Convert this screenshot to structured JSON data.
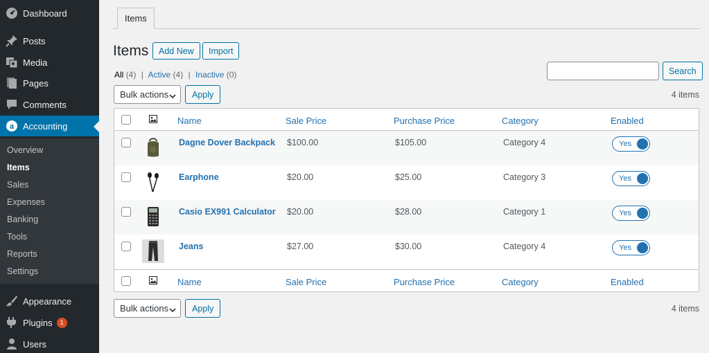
{
  "sidebar": {
    "items_top": [
      {
        "label": "Dashboard",
        "icon": "dashboard-icon"
      },
      {
        "label": "Posts",
        "icon": "pin-icon"
      },
      {
        "label": "Media",
        "icon": "media-icon"
      },
      {
        "label": "Pages",
        "icon": "pages-icon"
      },
      {
        "label": "Comments",
        "icon": "comment-icon"
      },
      {
        "label": "Accounting",
        "icon": "accounting-icon"
      }
    ],
    "submenu": [
      "Overview",
      "Items",
      "Sales",
      "Expenses",
      "Banking",
      "Tools",
      "Reports",
      "Settings"
    ],
    "items_bottom": [
      {
        "label": "Appearance",
        "icon": "brush-icon"
      },
      {
        "label": "Plugins",
        "icon": "plugin-icon",
        "badge": "1"
      },
      {
        "label": "Users",
        "icon": "user-icon"
      }
    ]
  },
  "tabs": [
    "Items"
  ],
  "header": {
    "title": "Items",
    "add_new": "Add New",
    "import": "Import"
  },
  "filters": {
    "all": "All",
    "all_count": "(4)",
    "active": "Active",
    "active_count": "(4)",
    "inactive": "Inactive",
    "inactive_count": "(0)",
    "sep": "|"
  },
  "search": {
    "button": "Search",
    "value": ""
  },
  "bulk": {
    "label": "Bulk actions",
    "apply": "Apply",
    "count": "4 items"
  },
  "table": {
    "columns": [
      "Name",
      "Sale Price",
      "Purchase Price",
      "Category",
      "Enabled"
    ],
    "rows": [
      {
        "name": "Dagne Dover Backpack",
        "sale": "$100.00",
        "purchase": "$105.00",
        "category": "Category 4",
        "enabled": "Yes",
        "thumb": "backpack"
      },
      {
        "name": "Earphone",
        "sale": "$20.00",
        "purchase": "$25.00",
        "category": "Category 3",
        "enabled": "Yes",
        "thumb": "earphone"
      },
      {
        "name": "Casio EX991 Calculator",
        "sale": "$20.00",
        "purchase": "$28.00",
        "category": "Category 1",
        "enabled": "Yes",
        "thumb": "calculator"
      },
      {
        "name": "Jeans",
        "sale": "$27.00",
        "purchase": "$30.00",
        "category": "Category 4",
        "enabled": "Yes",
        "thumb": "jeans"
      }
    ]
  },
  "colors": {
    "sidebar_bg": "#23282d",
    "accent": "#0073aa",
    "link": "#2271b1",
    "badge": "#d54e21"
  }
}
